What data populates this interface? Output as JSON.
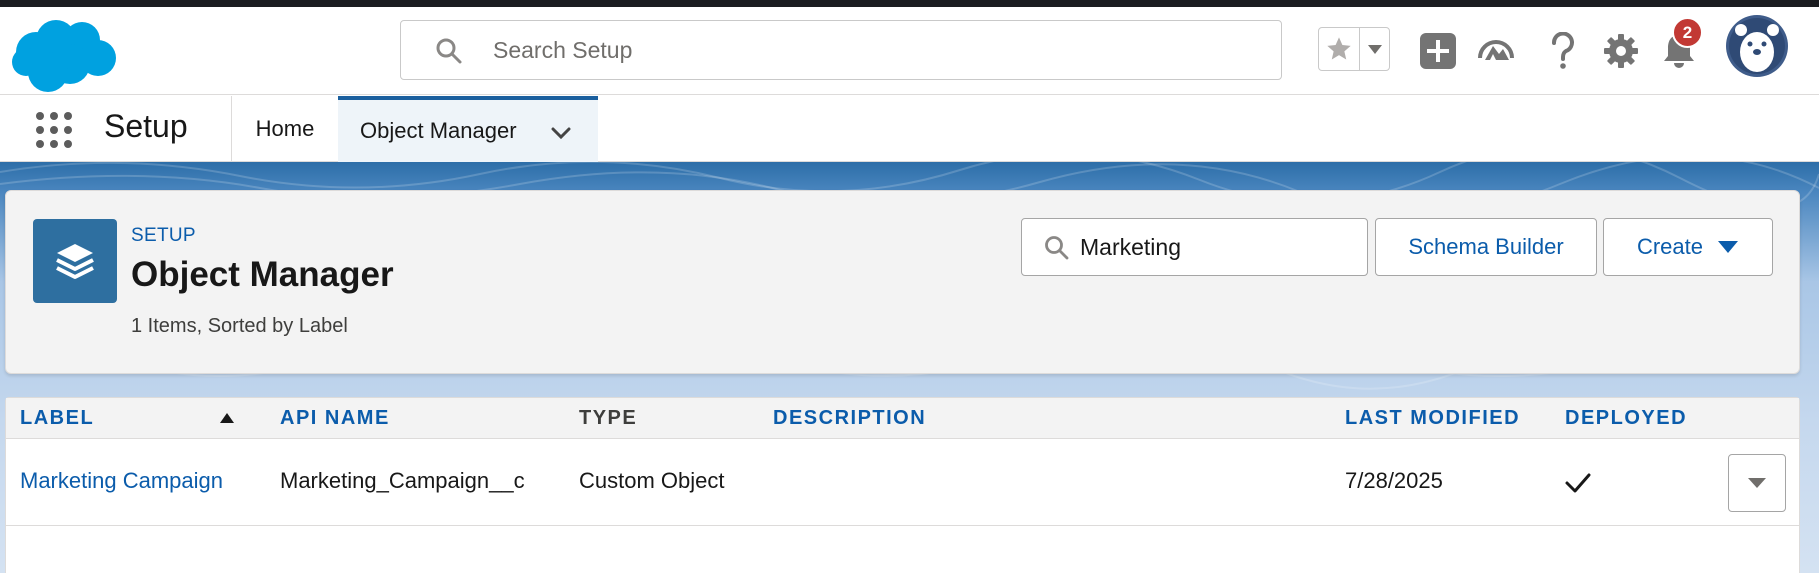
{
  "header": {
    "search_placeholder": "Search Setup",
    "notification_count": "2"
  },
  "context_bar": {
    "app_name": "Setup",
    "tabs": [
      {
        "label": "Home"
      },
      {
        "label": "Object Manager"
      }
    ]
  },
  "object_manager": {
    "eyebrow": "SETUP",
    "title": "Object Manager",
    "meta": "1 Items, Sorted by Label",
    "search_value": "Marketing",
    "schema_builder_label": "Schema Builder",
    "create_label": "Create"
  },
  "table": {
    "columns": [
      "LABEL",
      "API NAME",
      "TYPE",
      "DESCRIPTION",
      "LAST MODIFIED",
      "DEPLOYED"
    ],
    "rows": [
      {
        "label": "Marketing Campaign",
        "api_name": "Marketing_Campaign__c",
        "type": "Custom Object",
        "description": "",
        "last_modified": "7/28/2025",
        "deployed": true
      }
    ]
  },
  "colors": {
    "brand_cloud": "#00a1e0",
    "link_blue": "#0b5cab",
    "tile_blue": "#2e6fa0",
    "badge_red": "#c23934",
    "header_band": "#2d6ea8"
  },
  "icons": [
    "salesforce-cloud-logo",
    "search-icon",
    "star-icon",
    "chevron-down-icon",
    "plus-icon",
    "trailhead-icon",
    "help-icon",
    "gear-icon",
    "bell-icon",
    "avatar-bear",
    "app-launcher-icon",
    "layers-icon",
    "check-icon"
  ]
}
